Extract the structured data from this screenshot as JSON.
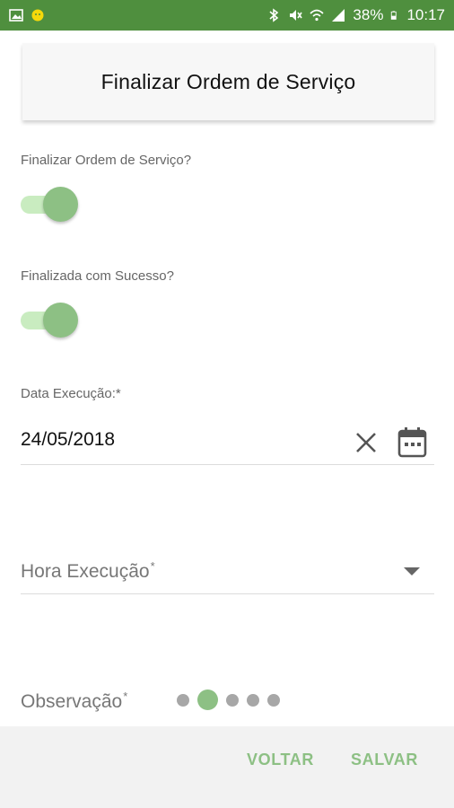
{
  "status_bar": {
    "battery": "38%",
    "time": "10:17",
    "left_icons": [
      "image-icon",
      "android-icon"
    ],
    "right_icons": [
      "bluetooth-icon",
      "mute-icon",
      "wifi-icon",
      "signal-icon",
      "battery-icon"
    ]
  },
  "header": {
    "title": "Finalizar Ordem de Serviço"
  },
  "form": {
    "finalizar_label": "Finalizar Ordem de Serviço?",
    "finalizar_on": true,
    "sucesso_label": "Finalizada com Sucesso?",
    "sucesso_on": true,
    "data_label": "Data Execução:*",
    "data_value": "24/05/2018",
    "hora_label": "Hora Execução",
    "hora_required": "*",
    "obs_label": "Observação",
    "obs_required": "*"
  },
  "loading_dots": {
    "count": 5,
    "active_index": 1
  },
  "footer": {
    "back_label": "VOLTAR",
    "save_label": "SALVAR"
  },
  "colors": {
    "status_bar": "#4f8f3e",
    "accent": "#8dc084",
    "track": "#c9ecc0"
  }
}
